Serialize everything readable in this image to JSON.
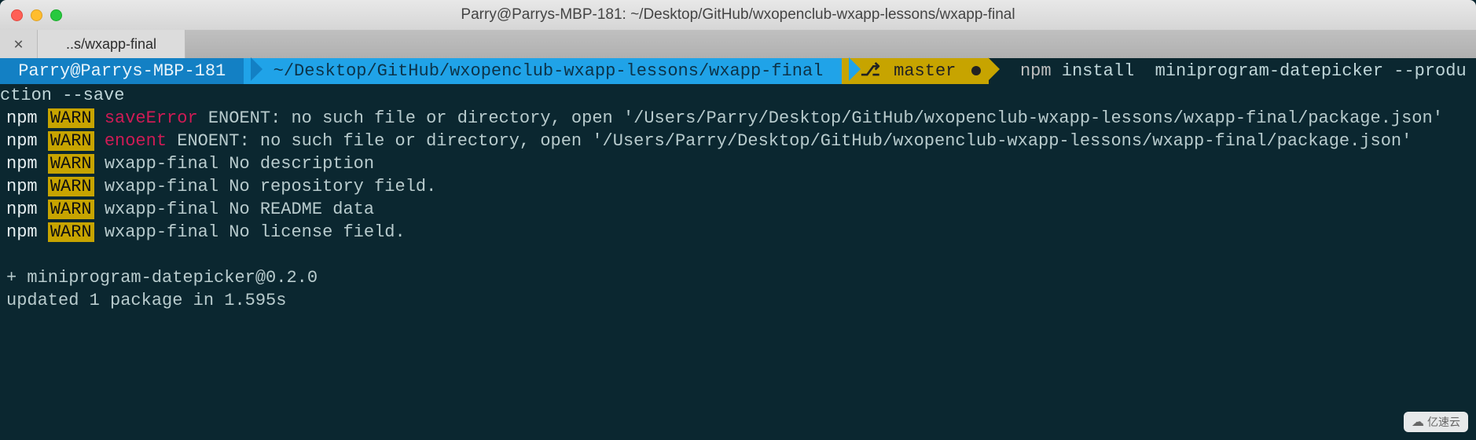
{
  "window": {
    "title": "Parry@Parrys-MBP-181: ~/Desktop/GitHub/wxopenclub-wxapp-lessons/wxapp-final"
  },
  "tab": {
    "close_glyph": "✕",
    "label": "..s/wxapp-final"
  },
  "prompt": {
    "user": " Parry@Parrys-MBP-181 ",
    "path": " ~/Desktop/GitHub/wxopenclub-wxapp-lessons/wxapp-final ",
    "branch_icon": "⎇",
    "branch": " master ",
    "command_npm": "  npm",
    "command_rest": " install  miniprogram-datepicker --production --save"
  },
  "output": {
    "l1_npm": "npm ",
    "l1_warn": "WARN",
    "l1_tag": " saveError",
    "l1_msg": " ENOENT: no such file or directory, open '/Users/Parry/Desktop/GitHub/wxopenclub-wxapp-lessons/wxapp-final/package.json'",
    "l2_npm": "npm ",
    "l2_warn": "WARN",
    "l2_tag": " enoent",
    "l2_msg": " ENOENT: no such file or directory, open '/Users/Parry/Desktop/GitHub/wxopenclub-wxapp-lessons/wxapp-final/package.json'",
    "l3_npm": "npm ",
    "l3_warn": "WARN",
    "l3_msg": " wxapp-final No description",
    "l4_npm": "npm ",
    "l4_warn": "WARN",
    "l4_msg": " wxapp-final No repository field.",
    "l5_npm": "npm ",
    "l5_warn": "WARN",
    "l5_msg": " wxapp-final No README data",
    "l6_npm": "npm ",
    "l6_warn": "WARN",
    "l6_msg": " wxapp-final No license field.",
    "blank": " ",
    "l7": "+ miniprogram-datepicker@0.2.0",
    "l8": "updated 1 package in 1.595s"
  },
  "watermark": {
    "text": "亿速云"
  }
}
